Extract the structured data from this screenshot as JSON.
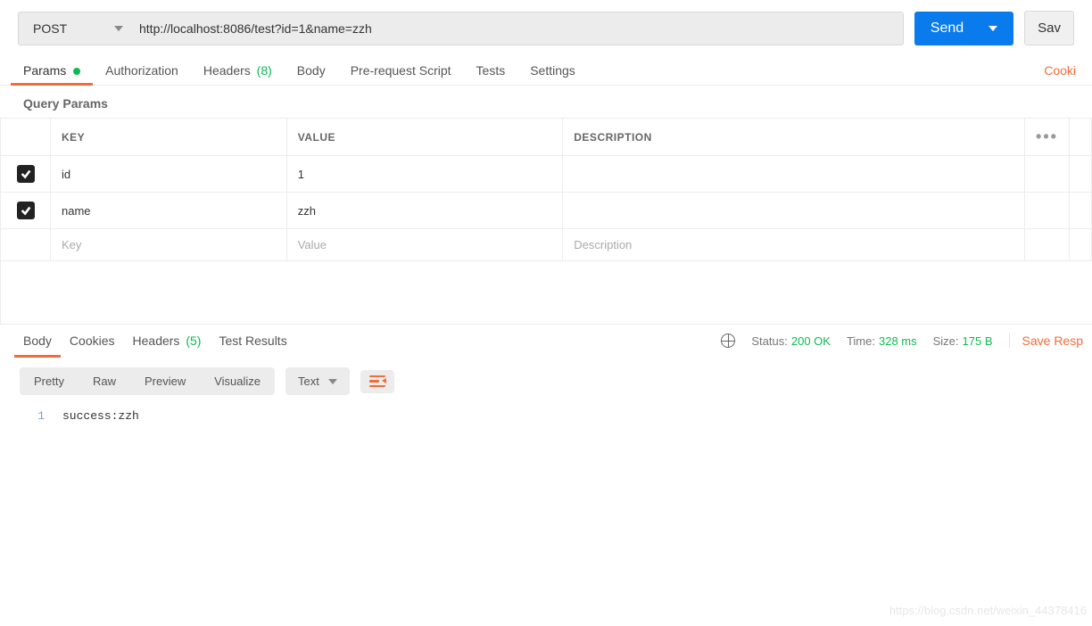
{
  "request": {
    "method": "POST",
    "url": "http://localhost:8086/test?id=1&name=zzh",
    "send_label": "Send",
    "save_label": "Sav"
  },
  "req_tabs": {
    "params": "Params",
    "auth": "Authorization",
    "headers": "Headers",
    "headers_count": "(8)",
    "body": "Body",
    "prereq": "Pre-request Script",
    "tests": "Tests",
    "settings": "Settings",
    "cookies": "Cooki"
  },
  "qp": {
    "heading": "Query Params",
    "cols": {
      "key": "KEY",
      "value": "VALUE",
      "desc": "DESCRIPTION"
    },
    "rows": [
      {
        "checked": true,
        "key": "id",
        "value": "1",
        "desc": ""
      },
      {
        "checked": true,
        "key": "name",
        "value": "zzh",
        "desc": ""
      }
    ],
    "placeholders": {
      "key": "Key",
      "value": "Value",
      "desc": "Description"
    }
  },
  "resp_tabs": {
    "body": "Body",
    "cookies": "Cookies",
    "headers": "Headers",
    "headers_count": "(5)",
    "tests": "Test Results"
  },
  "resp_meta": {
    "status_label": "Status:",
    "status_val": "200 OK",
    "time_label": "Time:",
    "time_val": "328 ms",
    "size_label": "Size:",
    "size_val": "175 B",
    "save_resp": "Save Resp"
  },
  "fmt": {
    "pretty": "Pretty",
    "raw": "Raw",
    "preview": "Preview",
    "visualize": "Visualize",
    "lang": "Text"
  },
  "response_body": {
    "line_no": "1",
    "text": "success:zzh"
  },
  "watermark": "https://blog.csdn.net/weixin_44378416"
}
